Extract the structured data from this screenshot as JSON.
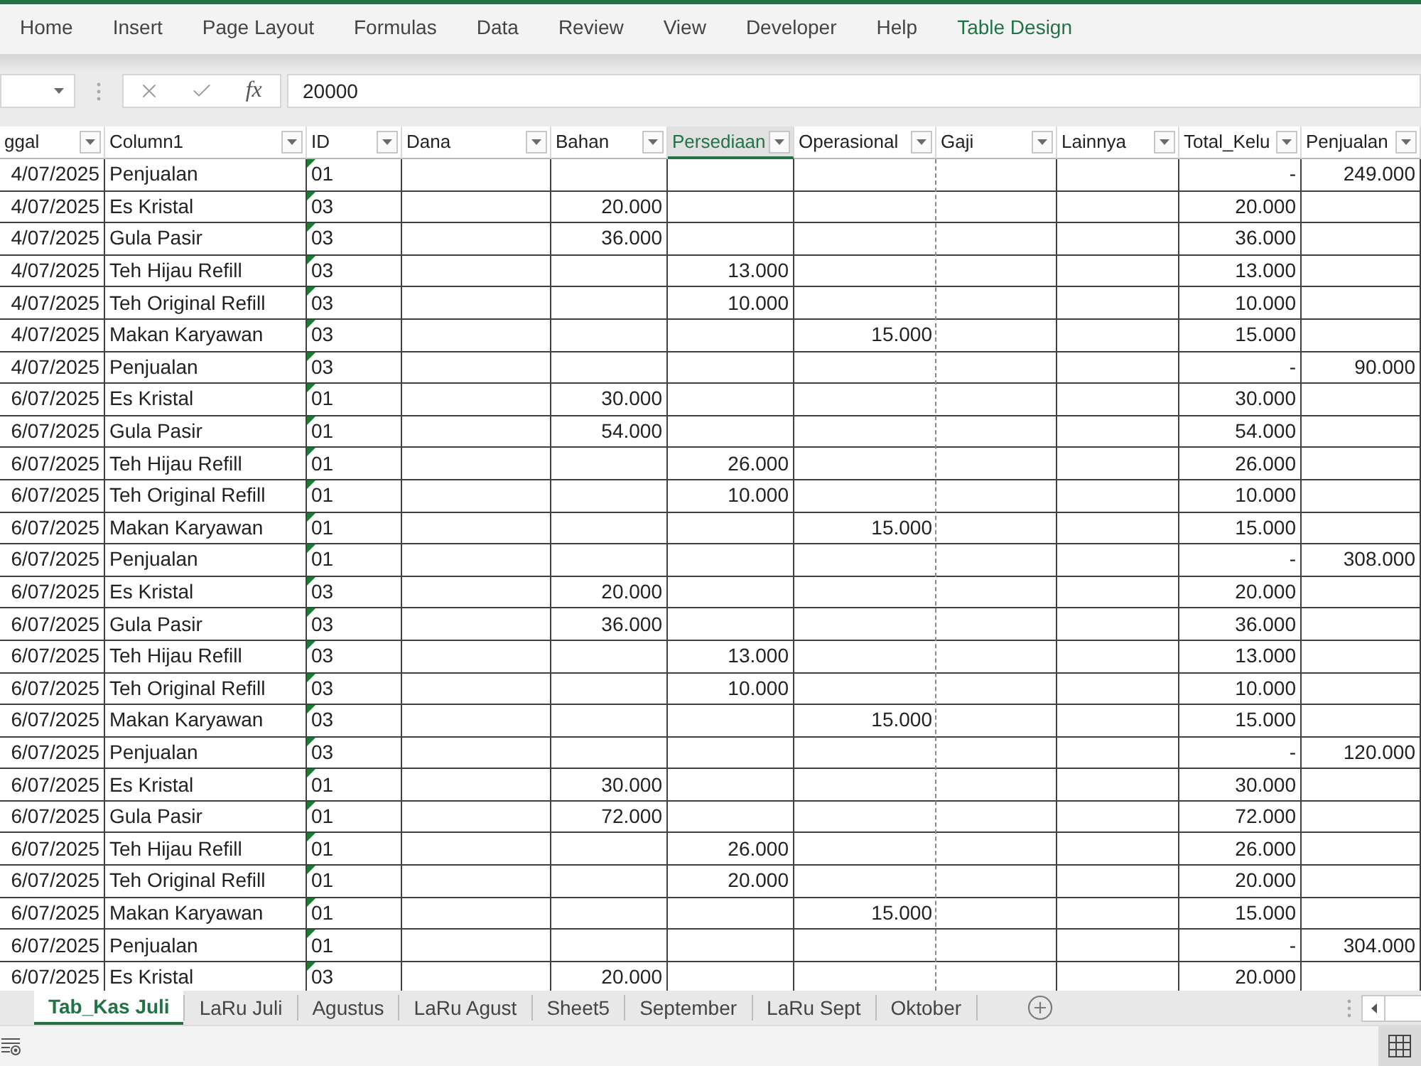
{
  "ribbon": {
    "tabs": [
      {
        "label": "Home",
        "selected": false,
        "contextual": false
      },
      {
        "label": "Insert",
        "selected": false,
        "contextual": false
      },
      {
        "label": "Page Layout",
        "selected": false,
        "contextual": false
      },
      {
        "label": "Formulas",
        "selected": false,
        "contextual": false
      },
      {
        "label": "Data",
        "selected": false,
        "contextual": false
      },
      {
        "label": "Review",
        "selected": false,
        "contextual": false
      },
      {
        "label": "View",
        "selected": false,
        "contextual": false
      },
      {
        "label": "Developer",
        "selected": false,
        "contextual": false
      },
      {
        "label": "Help",
        "selected": false,
        "contextual": false
      },
      {
        "label": "Table Design",
        "selected": false,
        "contextual": true
      }
    ]
  },
  "formula_bar": {
    "function_label": "fx",
    "value": "20000"
  },
  "table": {
    "columns": [
      {
        "label": "ggal",
        "selected": false,
        "page_break_after": false
      },
      {
        "label": "Column1",
        "selected": false,
        "page_break_after": false
      },
      {
        "label": "ID",
        "selected": false,
        "page_break_after": false
      },
      {
        "label": "Dana",
        "selected": false,
        "page_break_after": false
      },
      {
        "label": "Bahan",
        "selected": false,
        "page_break_after": false
      },
      {
        "label": "Persediaan",
        "selected": true,
        "page_break_after": false
      },
      {
        "label": "Operasional",
        "selected": false,
        "page_break_after": true
      },
      {
        "label": "Gaji",
        "selected": false,
        "page_break_after": false
      },
      {
        "label": "Lainnya",
        "selected": false,
        "page_break_after": false
      },
      {
        "label": "Total_Kelu",
        "selected": false,
        "page_break_after": false
      },
      {
        "label": "Penjualan",
        "selected": false,
        "page_break_after": false
      }
    ],
    "rows": [
      {
        "column_1": "4/07/2025",
        "column1": "Penjualan",
        "id": "01",
        "flagged": true,
        "total_kelu": "-",
        "penjualan": "249.000"
      },
      {
        "column_1": "4/07/2025",
        "column1": "Es Kristal",
        "id": "03",
        "flagged": true,
        "bahan": "20.000",
        "total_kelu": "20.000"
      },
      {
        "column_1": "4/07/2025",
        "column1": "Gula Pasir",
        "id": "03",
        "flagged": true,
        "bahan": "36.000",
        "total_kelu": "36.000"
      },
      {
        "column_1": "4/07/2025",
        "column1": "Teh Hijau Refill",
        "id": "03",
        "flagged": true,
        "persediaan": "13.000",
        "total_kelu": "13.000"
      },
      {
        "column_1": "4/07/2025",
        "column1": "Teh Original Refill",
        "id": "03",
        "flagged": true,
        "persediaan": "10.000",
        "total_kelu": "10.000"
      },
      {
        "column_1": "4/07/2025",
        "column1": "Makan Karyawan",
        "id": "03",
        "flagged": true,
        "operasional": "15.000",
        "total_kelu": "15.000"
      },
      {
        "column_1": "4/07/2025",
        "column1": "Penjualan",
        "id": "03",
        "flagged": true,
        "total_kelu": "-",
        "penjualan": "90.000"
      },
      {
        "column_1": "6/07/2025",
        "column1": "Es Kristal",
        "id": "01",
        "flagged": true,
        "bahan": "30.000",
        "total_kelu": "30.000"
      },
      {
        "column_1": "6/07/2025",
        "column1": "Gula Pasir",
        "id": "01",
        "flagged": true,
        "bahan": "54.000",
        "total_kelu": "54.000"
      },
      {
        "column_1": "6/07/2025",
        "column1": "Teh Hijau Refill",
        "id": "01",
        "flagged": true,
        "persediaan": "26.000",
        "total_kelu": "26.000"
      },
      {
        "column_1": "6/07/2025",
        "column1": "Teh Original Refill",
        "id": "01",
        "flagged": true,
        "persediaan": "10.000",
        "total_kelu": "10.000"
      },
      {
        "column_1": "6/07/2025",
        "column1": "Makan Karyawan",
        "id": "01",
        "flagged": true,
        "operasional": "15.000",
        "total_kelu": "15.000"
      },
      {
        "column_1": "6/07/2025",
        "column1": "Penjualan",
        "id": "01",
        "flagged": true,
        "total_kelu": "-",
        "penjualan": "308.000"
      },
      {
        "column_1": "6/07/2025",
        "column1": "Es Kristal",
        "id": "03",
        "flagged": true,
        "bahan": "20.000",
        "total_kelu": "20.000"
      },
      {
        "column_1": "6/07/2025",
        "column1": "Gula Pasir",
        "id": "03",
        "flagged": true,
        "bahan": "36.000",
        "total_kelu": "36.000"
      },
      {
        "column_1": "6/07/2025",
        "column1": "Teh Hijau Refill",
        "id": "03",
        "flagged": true,
        "persediaan": "13.000",
        "total_kelu": "13.000"
      },
      {
        "column_1": "6/07/2025",
        "column1": "Teh Original Refill",
        "id": "03",
        "flagged": true,
        "persediaan": "10.000",
        "total_kelu": "10.000"
      },
      {
        "column_1": "6/07/2025",
        "column1": "Makan Karyawan",
        "id": "03",
        "flagged": true,
        "operasional": "15.000",
        "total_kelu": "15.000"
      },
      {
        "column_1": "6/07/2025",
        "column1": "Penjualan",
        "id": "03",
        "flagged": true,
        "total_kelu": "-",
        "penjualan": "120.000"
      },
      {
        "column_1": "6/07/2025",
        "column1": "Es Kristal",
        "id": "01",
        "flagged": true,
        "bahan": "30.000",
        "total_kelu": "30.000"
      },
      {
        "column_1": "6/07/2025",
        "column1": "Gula Pasir",
        "id": "01",
        "flagged": true,
        "bahan": "72.000",
        "total_kelu": "72.000"
      },
      {
        "column_1": "6/07/2025",
        "column1": "Teh Hijau Refill",
        "id": "01",
        "flagged": true,
        "persediaan": "26.000",
        "total_kelu": "26.000"
      },
      {
        "column_1": "6/07/2025",
        "column1": "Teh Original Refill",
        "id": "01",
        "flagged": true,
        "persediaan": "20.000",
        "total_kelu": "20.000"
      },
      {
        "column_1": "6/07/2025",
        "column1": "Makan Karyawan",
        "id": "01",
        "flagged": true,
        "operasional": "15.000",
        "total_kelu": "15.000"
      },
      {
        "column_1": "6/07/2025",
        "column1": "Penjualan",
        "id": "01",
        "flagged": true,
        "total_kelu": "-",
        "penjualan": "304.000"
      },
      {
        "column_1": "6/07/2025",
        "column1": "Es Kristal",
        "id": "03",
        "flagged": true,
        "bahan": "20.000",
        "total_kelu": "20.000"
      }
    ]
  },
  "sheet_tabs": [
    {
      "label": "Tab_Kas Juli",
      "selected": true
    },
    {
      "label": "LaRu Juli",
      "selected": false
    },
    {
      "label": "Agustus",
      "selected": false
    },
    {
      "label": "LaRu Agust",
      "selected": false
    },
    {
      "label": "Sheet5",
      "selected": false
    },
    {
      "label": "September",
      "selected": false
    },
    {
      "label": "LaRu Sept",
      "selected": false
    },
    {
      "label": "Oktober",
      "selected": false
    }
  ]
}
